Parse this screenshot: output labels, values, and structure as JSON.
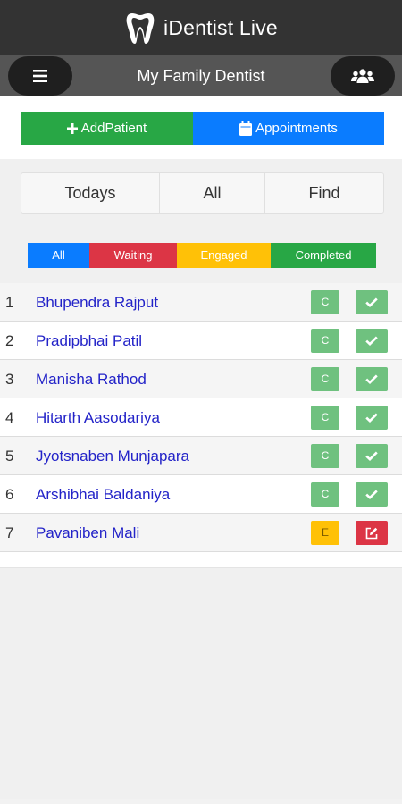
{
  "app": {
    "title": "iDentist Live",
    "logo_icon": "tooth-icon"
  },
  "subheader": {
    "title": "My Family Dentist",
    "menu_icon": "hamburger-icon",
    "users_icon": "users-icon"
  },
  "actions": {
    "add_patient": "AddPatient",
    "appointments": "Appointments"
  },
  "tabs": [
    {
      "label": "Todays"
    },
    {
      "label": "All"
    },
    {
      "label": "Find"
    }
  ],
  "filters": [
    {
      "label": "All",
      "color": "#0a7cff"
    },
    {
      "label": "Waiting",
      "color": "#dc3545"
    },
    {
      "label": "Engaged",
      "color": "#ffc107"
    },
    {
      "label": "Completed",
      "color": "#28a745"
    }
  ],
  "patients": [
    {
      "num": "1",
      "name": "Bhupendra Rajput",
      "status": "C",
      "action": "check-icon"
    },
    {
      "num": "2",
      "name": "Pradipbhai Patil",
      "status": "C",
      "action": "check-icon"
    },
    {
      "num": "3",
      "name": "Manisha Rathod",
      "status": "C",
      "action": "check-icon"
    },
    {
      "num": "4",
      "name": "Hitarth Aasodariya",
      "status": "C",
      "action": "check-icon"
    },
    {
      "num": "5",
      "name": "Jyotsnaben Munjapara",
      "status": "C",
      "action": "check-icon"
    },
    {
      "num": "6",
      "name": "Arshibhai Baldaniya",
      "status": "C",
      "action": "check-icon"
    },
    {
      "num": "7",
      "name": "Pavaniben Mali",
      "status": "E",
      "action": "edit-icon"
    }
  ],
  "colors": {
    "completed_badge": "#6fc17f",
    "engaged_badge": "#ffc107",
    "edit_action": "#dc3545",
    "name_link": "#2323c8"
  }
}
